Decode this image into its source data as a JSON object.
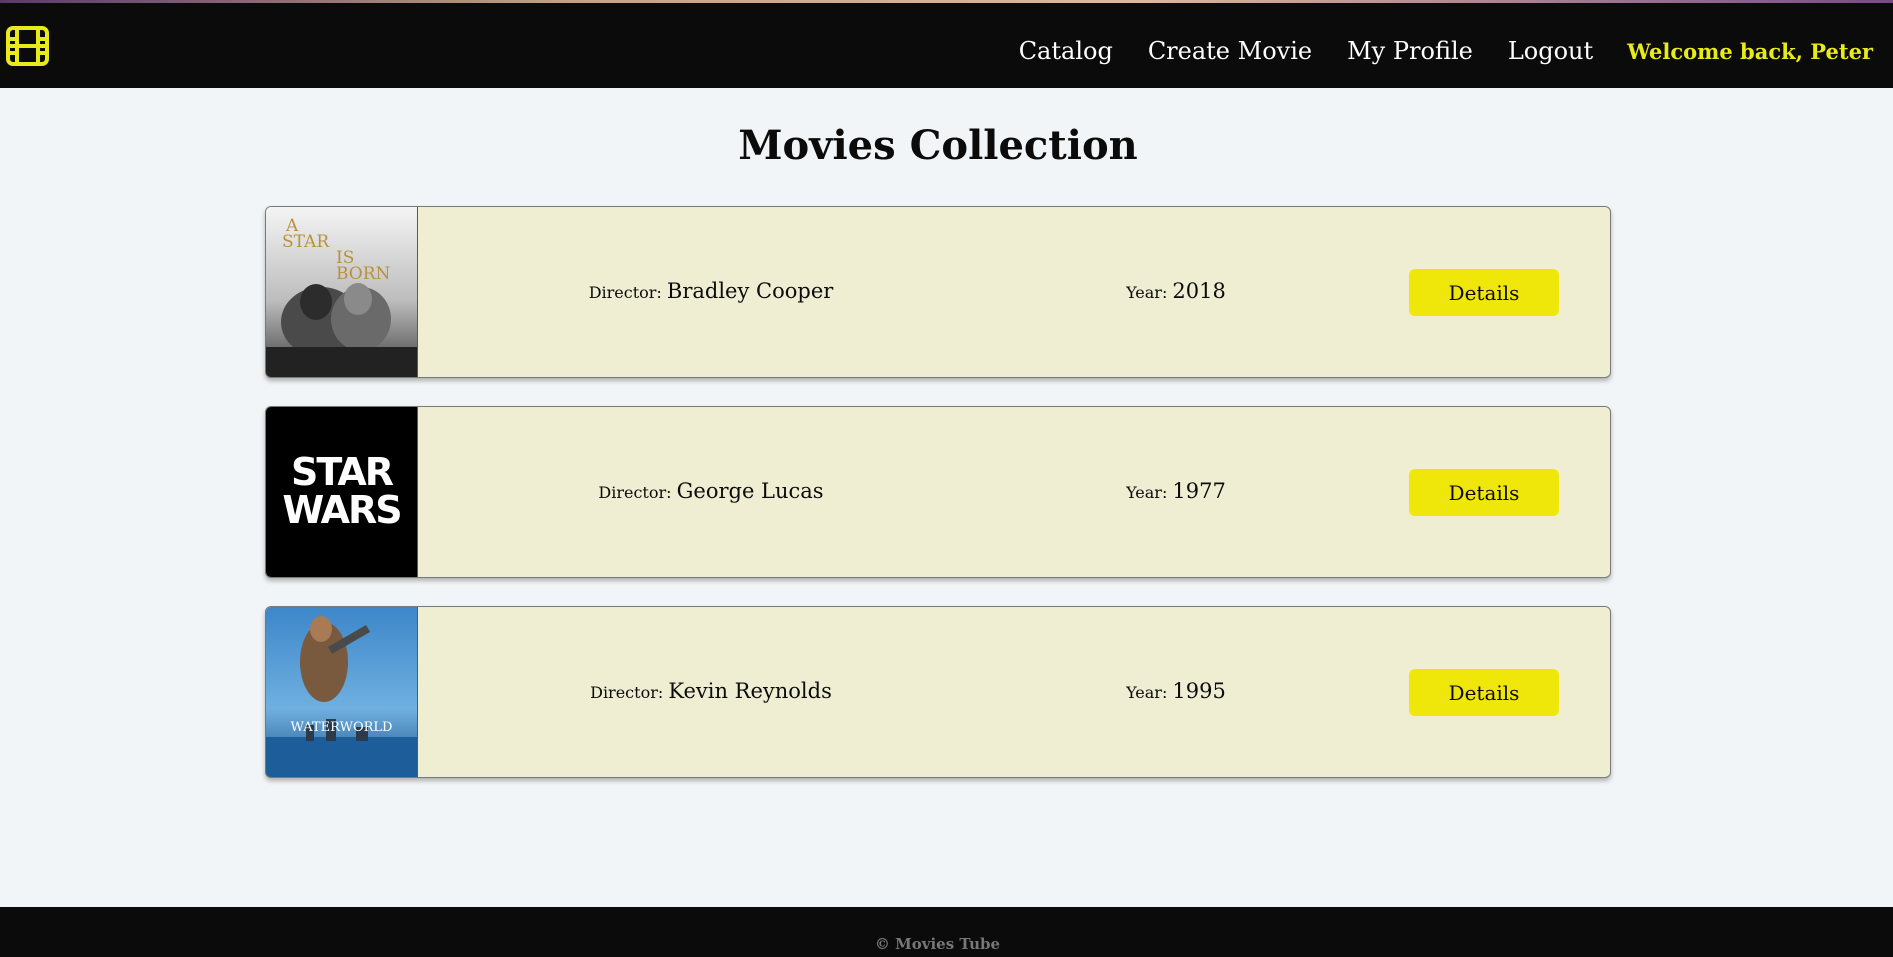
{
  "header": {
    "logo_icon": "film-icon",
    "accent_color": "#e8ea1a",
    "nav": [
      {
        "label": "Catalog"
      },
      {
        "label": "Create Movie"
      },
      {
        "label": "My Profile"
      },
      {
        "label": "Logout"
      }
    ],
    "welcome": "Welcome back, Peter"
  },
  "main": {
    "title": "Movies Collection",
    "movies": [
      {
        "poster_text": "A STAR IS BORN",
        "director_label": "Director:",
        "director": "Bradley Cooper",
        "year_label": "Year:",
        "year": "2018",
        "details_label": "Details"
      },
      {
        "poster_text": "STAR WARS",
        "director_label": "Director:",
        "director": "George Lucas",
        "year_label": "Year:",
        "year": "1977",
        "details_label": "Details"
      },
      {
        "poster_text": "WATERWORLD",
        "director_label": "Director:",
        "director": "Kevin Reynolds",
        "year_label": "Year:",
        "year": "1995",
        "details_label": "Details"
      }
    ]
  },
  "footer": {
    "copyright": "© Movies Tube"
  }
}
